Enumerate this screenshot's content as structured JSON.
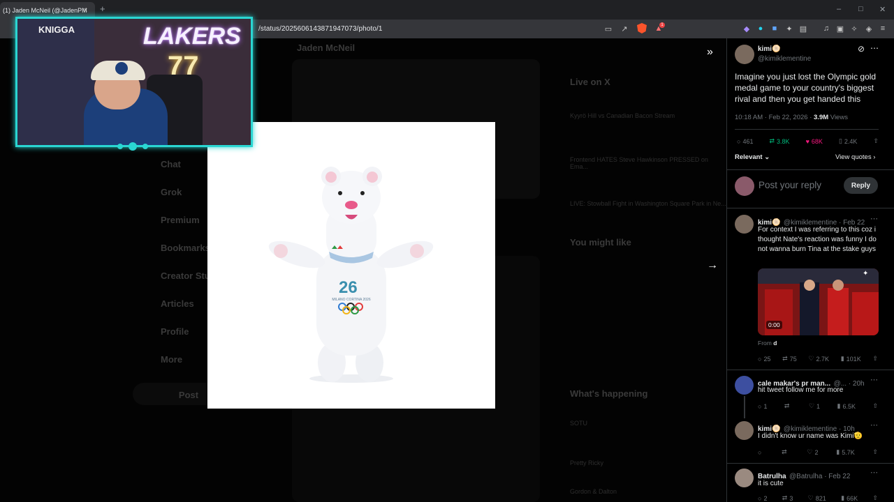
{
  "browser": {
    "tab_title": "(1) Jaden McNeil (@JadenPM",
    "tab_close": "×",
    "new_tab": "+",
    "url": "/status/2025606143871947073/photo/1",
    "win_min": "–",
    "win_max": "□",
    "win_close": "✕",
    "badge_count": "1"
  },
  "webcam": {
    "sign_left": "KNIGGA",
    "sign_right": "LAKERS",
    "jersey_number": "77"
  },
  "photo": {
    "plush_logo_text": "MILANO CORTINA 2026"
  },
  "background_page": {
    "header_name": "Jaden McNeil",
    "nav": [
      "Chat",
      "Grok",
      "Premium",
      "Bookmarks",
      "Creator Stu",
      "Articles",
      "Profile",
      "More"
    ],
    "post_button": "Post",
    "live_title": "Live on X",
    "live_items": [
      "Kyyrö Hill vs Canadian Bacon Stream",
      "Frontend HATES Steve Hawkinson PRESSED on Ema...",
      "LIVE: Stowball Fight in Washington Square Park in Ne..."
    ],
    "you_might_like": "You might like",
    "whats_happening": "What's happening",
    "trend_items": [
      "SOTU",
      "Pretty Ricky",
      "Gordon & Dalton"
    ]
  },
  "panel": {
    "op": {
      "name": "kimi🫓",
      "handle": "@kimiklementine",
      "text": "Imagine you just lost the Olympic gold medal game to your country's biggest rival and then you get handed this",
      "time": "10:18 AM · Feb 22, 2026 · ",
      "views_count": "3.9M",
      "views_label": " Views",
      "replies": "461",
      "reposts": "3.8K",
      "likes": "68K",
      "bookmarks": "2.4K",
      "sort": "Relevant",
      "view_quotes": "View quotes"
    },
    "reply_placeholder": "Post your reply",
    "reply_button": "Reply",
    "replies": [
      {
        "name": "kimi🫓",
        "handle": "@kimiklementine · Feb 22",
        "text": "For context I was referring to this coz i thought Nate's reaction was funny I do not wanna burn Tina at the stake guys",
        "video_time": "0:00",
        "from_label": "From ",
        "from_name": "d",
        "comments": "25",
        "reposts": "75",
        "likes": "2.7K",
        "views": "101K"
      },
      {
        "name": "cale makar's pr man...",
        "handle": "@... · 20h",
        "text": "hit tweet follow me for more",
        "comments": "1",
        "reposts": "",
        "likes": "1",
        "views": "6.5K"
      },
      {
        "name": "kimi🫓",
        "handle": "@kimiklementine · 10h",
        "text": "I didn't know ur name was Kimi🫡",
        "comments": "",
        "reposts": "",
        "likes": "2",
        "views": "5.7K"
      },
      {
        "name": "Batrulha",
        "handle": "@Batrulha · Feb 22",
        "text": "it is cute",
        "comments": "2",
        "reposts": "3",
        "likes": "821",
        "views": "66K"
      }
    ]
  },
  "colors": {
    "accent_cyan": "#2ad6d2",
    "like_pink": "#f91880",
    "repost_green": "#00ba7c"
  }
}
